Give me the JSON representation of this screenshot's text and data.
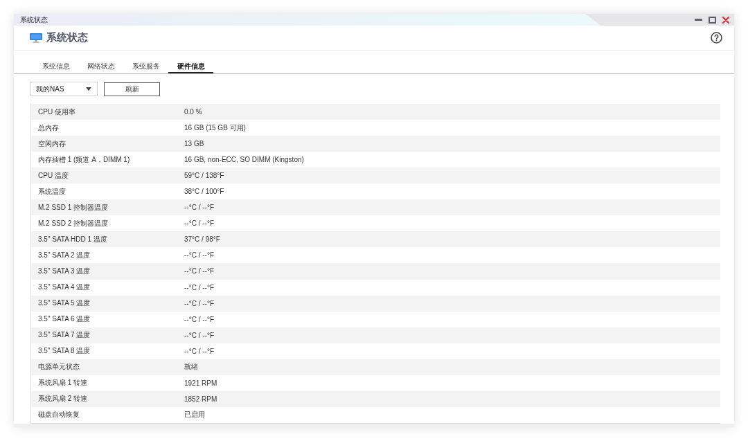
{
  "window": {
    "title": "系统状态"
  },
  "header": {
    "title": "系统状态"
  },
  "tabs": [
    {
      "label": "系统信息",
      "selected": false
    },
    {
      "label": "网络状态",
      "selected": false
    },
    {
      "label": "系统服务",
      "selected": false
    },
    {
      "label": "硬件信息",
      "selected": true
    }
  ],
  "toolbar": {
    "device_select": {
      "value": "我的NAS"
    },
    "buttons": [
      "刷新"
    ]
  },
  "table": {
    "rows": [
      {
        "name": "CPU 使用率",
        "value": "0.0 %"
      },
      {
        "name": "总内存",
        "value": "16 GB (15 GB 可用)"
      },
      {
        "name": "空闲内存",
        "value": "13 GB"
      },
      {
        "name": "内存插槽 1 (频道 A，DIMM 1)",
        "value": "16 GB, non-ECC, SO DIMM (Kingston)"
      },
      {
        "name": "CPU 温度",
        "value": "59°C / 138°F"
      },
      {
        "name": "系统温度",
        "value": "38°C / 100°F"
      },
      {
        "name": "M.2 SSD 1 控制器温度",
        "value": "--°C / --°F"
      },
      {
        "name": "M.2 SSD 2 控制器温度",
        "value": "--°C / --°F"
      },
      {
        "name": "3.5\" SATA HDD 1 温度",
        "value": "37°C / 98°F"
      },
      {
        "name": "3.5\" SATA 2 温度",
        "value": "--°C / --°F"
      },
      {
        "name": "3.5\" SATA 3 温度",
        "value": "--°C / --°F"
      },
      {
        "name": "3.5\" SATA 4 温度",
        "value": "--°C / --°F"
      },
      {
        "name": "3.5\" SATA 5 温度",
        "value": "--°C / --°F"
      },
      {
        "name": "3.5\" SATA 6 温度",
        "value": "--°C / --°F"
      },
      {
        "name": "3.5\" SATA 7 温度",
        "value": "--°C / --°F"
      },
      {
        "name": "3.5\" SATA 8 温度",
        "value": "--°C / --°F"
      },
      {
        "name": "电源单元状态",
        "value": "就绪"
      },
      {
        "name": "系统风扇 1 转速",
        "value": "1921 RPM"
      },
      {
        "name": "系统风扇 2 转速",
        "value": "1852 RPM"
      },
      {
        "name": "磁盘自动恢复",
        "value": "已启用"
      }
    ]
  }
}
